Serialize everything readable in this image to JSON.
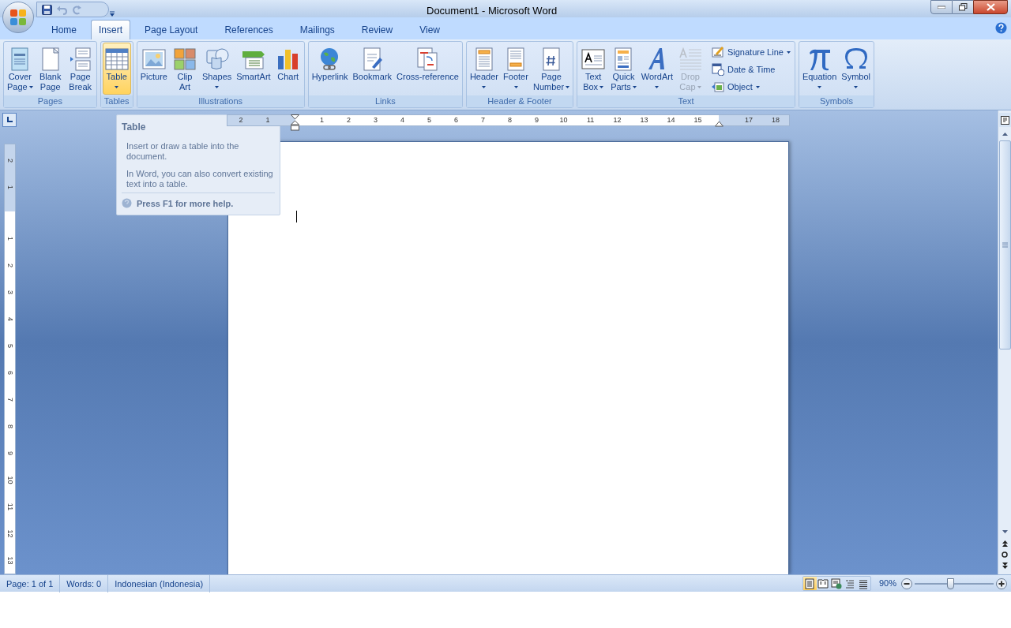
{
  "window": {
    "title": "Document1 - Microsoft Word"
  },
  "quick_access": [
    {
      "disabled": false
    },
    {
      "disabled": true
    },
    {
      "disabled": true
    }
  ],
  "tabs": [
    {
      "label": "Home",
      "selected": false
    },
    {
      "label": "Insert",
      "selected": true
    },
    {
      "label": "Page Layout",
      "selected": false
    },
    {
      "label": "References",
      "selected": false
    },
    {
      "label": "Mailings",
      "selected": false
    },
    {
      "label": "Review",
      "selected": false
    },
    {
      "label": "View",
      "selected": false
    }
  ],
  "ribbon": {
    "groups": [
      {
        "label": "Pages",
        "items": [
          {
            "kind": "large",
            "lines": [
              "Cover",
              "Page"
            ],
            "menu": true,
            "highlighted": false,
            "disabled": false
          },
          {
            "kind": "large",
            "lines": [
              "Blank",
              "Page"
            ],
            "menu": false,
            "highlighted": false,
            "disabled": false
          },
          {
            "kind": "large",
            "lines": [
              "Page",
              "Break"
            ],
            "menu": false,
            "highlighted": false,
            "disabled": false
          }
        ]
      },
      {
        "label": "Tables",
        "items": [
          {
            "kind": "large",
            "lines": [
              "Table"
            ],
            "menu": true,
            "highlighted": true,
            "disabled": false
          }
        ]
      },
      {
        "label": "Illustrations",
        "items": [
          {
            "kind": "large",
            "lines": [
              "Picture"
            ],
            "menu": false,
            "highlighted": false,
            "disabled": false
          },
          {
            "kind": "large",
            "lines": [
              "Clip",
              "Art"
            ],
            "menu": false,
            "highlighted": false,
            "disabled": false
          },
          {
            "kind": "large",
            "lines": [
              "Shapes"
            ],
            "menu": true,
            "highlighted": false,
            "disabled": false
          },
          {
            "kind": "large",
            "lines": [
              "SmartArt"
            ],
            "menu": false,
            "highlighted": false,
            "disabled": false
          },
          {
            "kind": "large",
            "lines": [
              "Chart"
            ],
            "menu": false,
            "highlighted": false,
            "disabled": false
          }
        ]
      },
      {
        "label": "Links",
        "items": [
          {
            "kind": "large",
            "lines": [
              "Hyperlink"
            ],
            "menu": false,
            "highlighted": false,
            "disabled": false
          },
          {
            "kind": "large",
            "lines": [
              "Bookmark"
            ],
            "menu": false,
            "highlighted": false,
            "disabled": false
          },
          {
            "kind": "large",
            "lines": [
              "Cross-reference"
            ],
            "menu": false,
            "highlighted": false,
            "disabled": false
          }
        ]
      },
      {
        "label": "Header & Footer",
        "items": [
          {
            "kind": "large",
            "lines": [
              "Header"
            ],
            "menu": true,
            "highlighted": false,
            "disabled": false
          },
          {
            "kind": "large",
            "lines": [
              "Footer"
            ],
            "menu": true,
            "highlighted": false,
            "disabled": false
          },
          {
            "kind": "large",
            "lines": [
              "Page",
              "Number"
            ],
            "menu": true,
            "highlighted": false,
            "disabled": false
          }
        ]
      },
      {
        "label": "Text",
        "items": [
          {
            "kind": "large",
            "lines": [
              "Text",
              "Box"
            ],
            "menu": true,
            "highlighted": false,
            "disabled": false
          },
          {
            "kind": "large",
            "lines": [
              "Quick",
              "Parts"
            ],
            "menu": true,
            "highlighted": false,
            "disabled": false
          },
          {
            "kind": "large",
            "lines": [
              "WordArt"
            ],
            "menu": true,
            "highlighted": false,
            "disabled": false
          },
          {
            "kind": "large",
            "lines": [
              "Drop",
              "Cap"
            ],
            "menu": true,
            "highlighted": false,
            "disabled": true
          },
          {
            "kind": "small",
            "lines": [
              "Signature Line"
            ],
            "menu": true,
            "highlighted": false,
            "disabled": false
          },
          {
            "kind": "small",
            "lines": [
              "Date & Time"
            ],
            "menu": false,
            "highlighted": false,
            "disabled": false
          },
          {
            "kind": "small",
            "lines": [
              "Object"
            ],
            "menu": true,
            "highlighted": false,
            "disabled": false
          }
        ]
      },
      {
        "label": "Symbols",
        "items": [
          {
            "kind": "large",
            "lines": [
              "Equation"
            ],
            "menu": true,
            "highlighted": false,
            "disabled": false
          },
          {
            "kind": "large",
            "lines": [
              "Symbol"
            ],
            "menu": true,
            "highlighted": false,
            "disabled": false
          }
        ]
      }
    ]
  },
  "ruler": {
    "left_numbers": [
      "2",
      "1"
    ],
    "body_numbers": [
      "1",
      "2",
      "3",
      "4",
      "5",
      "6",
      "7",
      "8",
      "9",
      "10",
      "11",
      "12",
      "13",
      "14",
      "15"
    ],
    "right_numbers": [
      "17",
      "18"
    ]
  },
  "vertical_ruler": {
    "top_numbers": [
      "2",
      "1"
    ],
    "body_numbers": [
      "1",
      "2",
      "3",
      "4",
      "5",
      "6",
      "7",
      "8",
      "9",
      "10",
      "11",
      "12",
      "13"
    ]
  },
  "tooltip": {
    "title": "Table",
    "lines": [
      "Insert or draw a table into the document.",
      "In Word, you can also convert existing text into a table."
    ],
    "help": "Press F1 for more help."
  },
  "status_bar": {
    "items": [
      "Page: 1 of 1",
      "Words: 0",
      "Indonesian (Indonesia)"
    ],
    "views": [
      {
        "selected": true
      },
      {
        "selected": false
      },
      {
        "selected": false
      },
      {
        "selected": false
      },
      {
        "selected": false
      }
    ],
    "zoom": "90%",
    "zoom_slider": {
      "level": 0.45
    }
  }
}
